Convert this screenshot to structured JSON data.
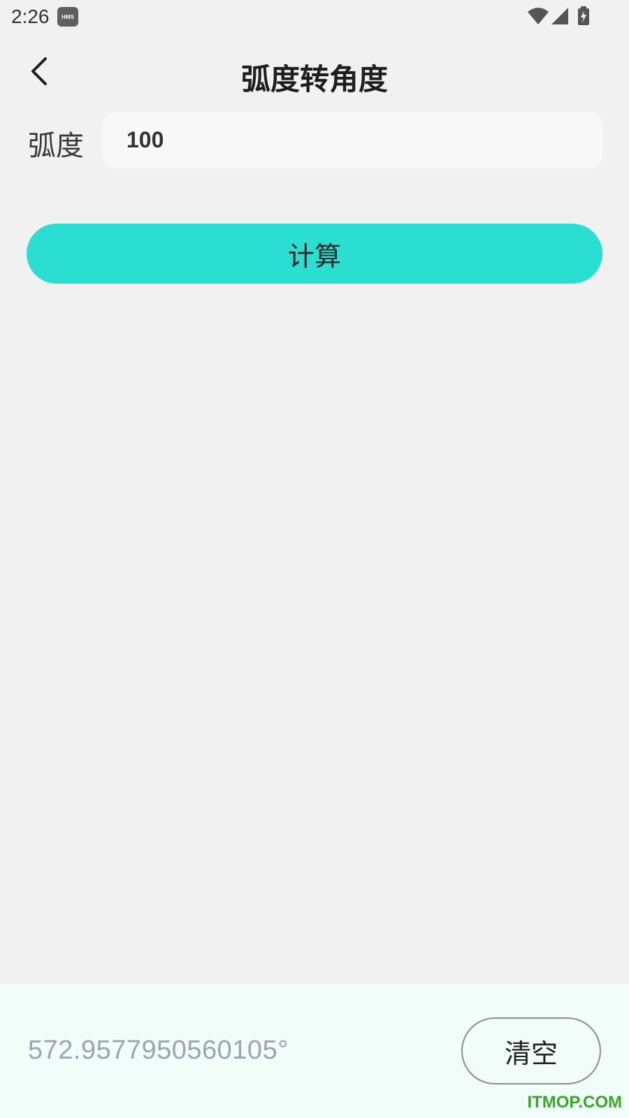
{
  "status_bar": {
    "time": "2:26",
    "hms_badge": "HMS",
    "icons": [
      "wifi-icon",
      "signal-icon",
      "battery-charging-icon"
    ]
  },
  "header": {
    "title": "弧度转角度",
    "back_icon": "chevron-left-icon"
  },
  "form": {
    "label": "弧度",
    "input_value": "100"
  },
  "calculate_button": {
    "label": "计算",
    "color": "#2adfd1"
  },
  "result": {
    "value": "572.9577950560105°",
    "clear_label": "清空"
  },
  "watermark": "ITMOP.COM"
}
